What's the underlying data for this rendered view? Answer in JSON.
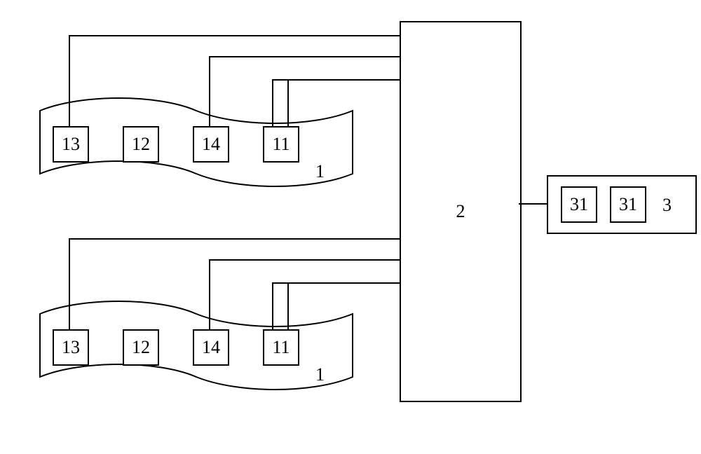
{
  "diagram": {
    "central_block": "2",
    "right_block": {
      "label": "3",
      "items": [
        "31",
        "31"
      ]
    },
    "modules": [
      {
        "label": "1",
        "boxes": [
          "13",
          "12",
          "14",
          "11"
        ]
      },
      {
        "label": "1",
        "boxes": [
          "13",
          "12",
          "14",
          "11"
        ]
      }
    ]
  }
}
